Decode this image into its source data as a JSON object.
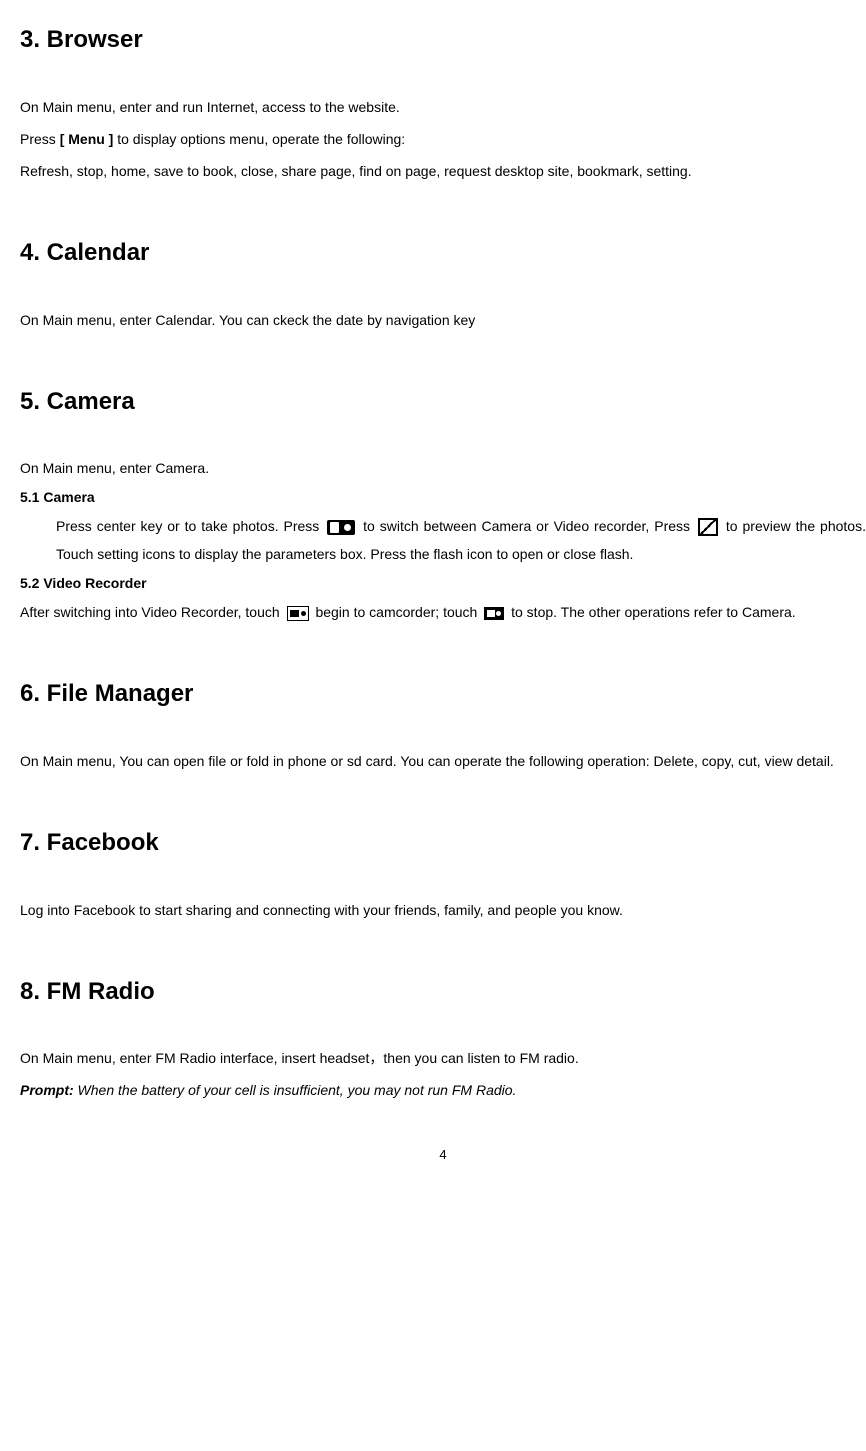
{
  "sections": {
    "browser": {
      "heading": "3. Browser",
      "line1a": "On Main menu, enter and run Internet, access to the website.",
      "line2a": "Press ",
      "line2b": "[ Menu ]",
      "line2c": " to display options menu, operate the following:",
      "line3": "Refresh, stop, home, save to book, close, share page, find on page, request desktop site, bookmark, setting."
    },
    "calendar": {
      "heading": "4. Calendar",
      "line1": "On Main menu, enter Calendar. You can ckeck the date by navigation key"
    },
    "camera": {
      "heading": "5. Camera",
      "line1": "On Main menu, enter Camera.",
      "sub1_heading": "5.1    Camera",
      "sub1_p1a": "Press center key or to take photos. Press ",
      "sub1_p1b": " to switch between Camera or Video recorder, Press ",
      "sub1_p1c": " to preview the photos. Touch setting icons to display the parameters box. Press the flash icon to open or close flash.",
      "sub2_heading": "5.2    Video Recorder",
      "sub2_p1a": "After switching into Video Recorder, touch ",
      "sub2_p1b": " begin to camcorder; touch ",
      "sub2_p1c": " to stop. The other operations refer to Camera."
    },
    "filemanager": {
      "heading": "6. File Manager",
      "line1": "On Main menu, You can open file or fold in phone or sd card. You can operate the following operation: Delete, copy, cut, view detail."
    },
    "facebook": {
      "heading": "7. Facebook",
      "line1": "Log into Facebook to start sharing and connecting with your friends, family, and people you know."
    },
    "fmradio": {
      "heading": "8. FM Radio",
      "line1": "On Main menu, enter FM Radio interface, insert headset，then you can listen to FM radio.",
      "prompt_label": "Prompt:",
      "prompt_text": " When the battery of your cell is insufficient, you may not run FM Radio."
    }
  },
  "page_number": "4"
}
